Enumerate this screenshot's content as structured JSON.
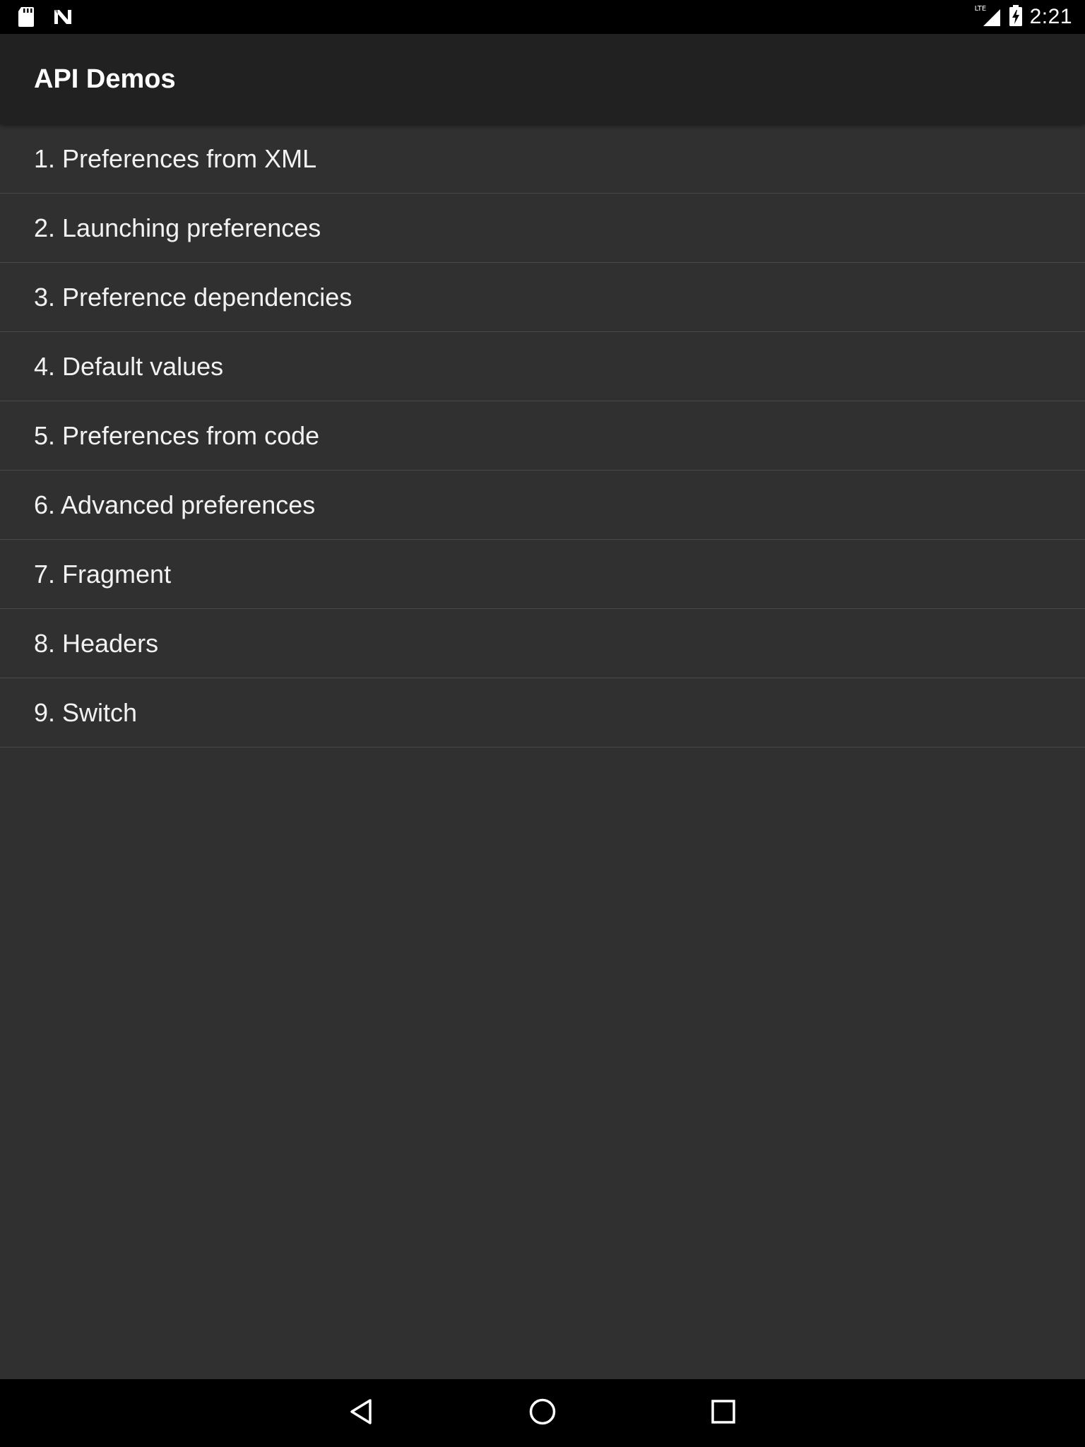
{
  "status_bar": {
    "left_icons": [
      "sd-card-icon",
      "n-logo-icon"
    ],
    "network_label": "LTE",
    "right_icons": [
      "signal-icon",
      "battery-charging-icon"
    ],
    "time": "2:21"
  },
  "action_bar": {
    "title": "API Demos"
  },
  "list": {
    "items": [
      {
        "label": "1. Preferences from XML"
      },
      {
        "label": "2. Launching preferences"
      },
      {
        "label": "3. Preference dependencies"
      },
      {
        "label": "4. Default values"
      },
      {
        "label": "5. Preferences from code"
      },
      {
        "label": "6. Advanced preferences"
      },
      {
        "label": "7. Fragment"
      },
      {
        "label": "8. Headers"
      },
      {
        "label": "9. Switch"
      }
    ]
  },
  "nav_bar": {
    "buttons": [
      "back-icon",
      "home-icon",
      "recents-icon"
    ]
  },
  "colors": {
    "background": "#303030",
    "action_bar": "#212121",
    "divider": "#4a4a4a",
    "system_bars": "#000000",
    "text": "#ffffff"
  }
}
